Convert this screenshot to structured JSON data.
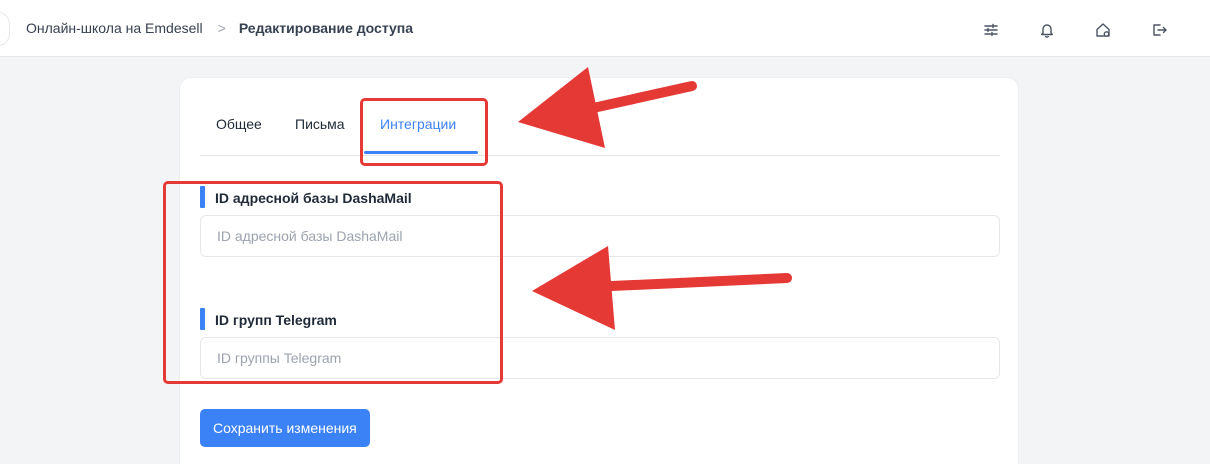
{
  "header": {
    "breadcrumb": {
      "parent": "Онлайн-школа на Emdesell",
      "separator": ">",
      "current": "Редактирование доступа"
    },
    "actions": [
      {
        "icon": "sliders-icon"
      },
      {
        "icon": "bell-icon"
      },
      {
        "icon": "home-settings-icon"
      },
      {
        "icon": "logout-icon"
      }
    ]
  },
  "tabs": {
    "items": [
      "Общее",
      "Письма",
      "Интеграции"
    ],
    "active": "Интеграции"
  },
  "form": {
    "dashamail": {
      "label": "ID адресной базы DashaMail",
      "placeholder": "ID адресной базы DashaMail",
      "value": ""
    },
    "telegram": {
      "label": "ID групп Telegram",
      "placeholder": "ID группы Telegram",
      "value": ""
    },
    "save_label": "Сохранить изменения"
  },
  "colors": {
    "accent": "#3b82f6",
    "annotation": "#e53935",
    "background": "#f3f4f6"
  }
}
